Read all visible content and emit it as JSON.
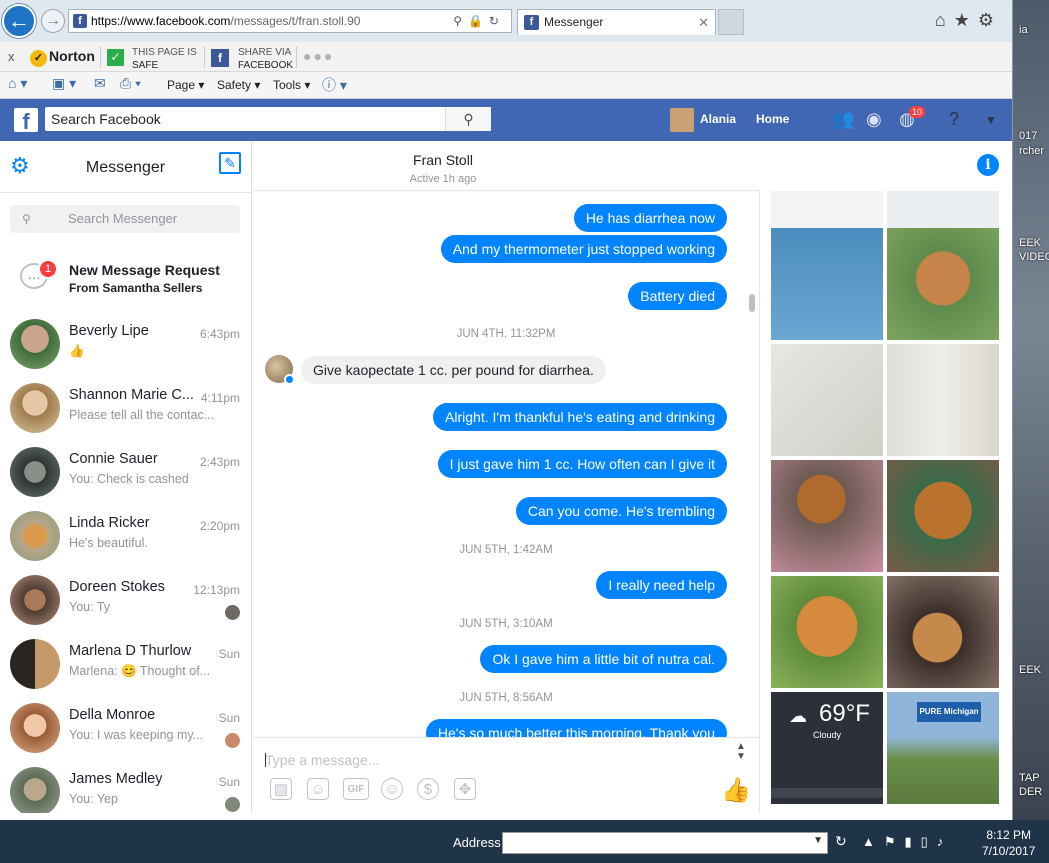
{
  "browser": {
    "url_host": "https://www.facebook.com",
    "url_rest": "/messages/t/fran.stoll.90",
    "tab_title": "Messenger",
    "tab_close": "✕",
    "back": "←",
    "forward": "→"
  },
  "norton": {
    "close": "x",
    "logo": "Norton",
    "page_status_line1": "THIS PAGE IS",
    "page_status_line2": "SAFE",
    "share_line1": "SHARE VIA",
    "share_line2": "FACEBOOK"
  },
  "commandbar": {
    "page": "Page ▾",
    "safety": "Safety ▾",
    "tools": "Tools ▾"
  },
  "facebook": {
    "search_placeholder": "Search Facebook",
    "user_name": "Alania",
    "home": "Home",
    "notification_count": "10"
  },
  "messenger": {
    "title": "Messenger",
    "search_placeholder": "Search Messenger",
    "request_badge": "1",
    "request_title": "New Message Request",
    "request_from": "From Samantha Sellers",
    "conversations": [
      {
        "name": "Beverly Lipe",
        "snippet": "👍",
        "time": "6:43pm"
      },
      {
        "name": "Shannon Marie C...",
        "snippet": "Please tell all the contac...",
        "time": "4:11pm"
      },
      {
        "name": "Connie Sauer",
        "snippet": "You: Check is cashed",
        "time": "2:43pm"
      },
      {
        "name": "Linda Ricker",
        "snippet": "He's beautiful.",
        "time": "2:20pm"
      },
      {
        "name": "Doreen Stokes",
        "snippet": "You: Ty",
        "time": "12:13pm"
      },
      {
        "name": "Marlena D Thurlow",
        "snippet": "Marlena: 😊 Thought of...",
        "time": "Sun"
      },
      {
        "name": "Della Monroe",
        "snippet": "You: I was keeping my...",
        "time": "Sun"
      },
      {
        "name": "James Medley",
        "snippet": "You: Yep",
        "time": "Sun"
      }
    ]
  },
  "conversation": {
    "name": "Fran Stoll",
    "status": "Active 1h ago",
    "messages": [
      {
        "text": "He has diarrhea now"
      },
      {
        "text": "And my thermometer just stopped working"
      },
      {
        "text": "Battery died"
      },
      {
        "stamp": "JUN 4TH, 11:32PM"
      },
      {
        "text": "Give kaopectate 1 cc. per pound for diarrhea."
      },
      {
        "text": "Alright. I'm thankful he's eating and drinking"
      },
      {
        "text": "I just gave him 1 cc.  How often can I give it"
      },
      {
        "text": "Can you come. He's trembling"
      },
      {
        "stamp": "JUN 5TH, 1:42AM"
      },
      {
        "text": "I really need help"
      },
      {
        "stamp": "JUN 5TH, 3:10AM"
      },
      {
        "text": "Ok I gave him a little bit of nutra cal."
      },
      {
        "stamp": "JUN 5TH, 8:56AM"
      },
      {
        "text": "He's so much better this morning. Thank you"
      }
    ],
    "compose_placeholder": "Type a message..."
  },
  "shared_photos": {
    "weather_temp": "69°F",
    "weather_cond": "Cloudy",
    "michigan_sign": "PURE Michigan"
  },
  "taskbar": {
    "address_label": "Address",
    "time": "8:12 PM",
    "date": "7/10/2017"
  },
  "desktop_labels": [
    "ia",
    "017",
    "rcher",
    "EEK",
    "VIDEO",
    "EEK",
    "TAP",
    "DER"
  ],
  "colors": {
    "facebook_blue": "#4267b2",
    "messenger_blue": "#0084ff",
    "incoming_bubble": "#f1f0f0"
  }
}
